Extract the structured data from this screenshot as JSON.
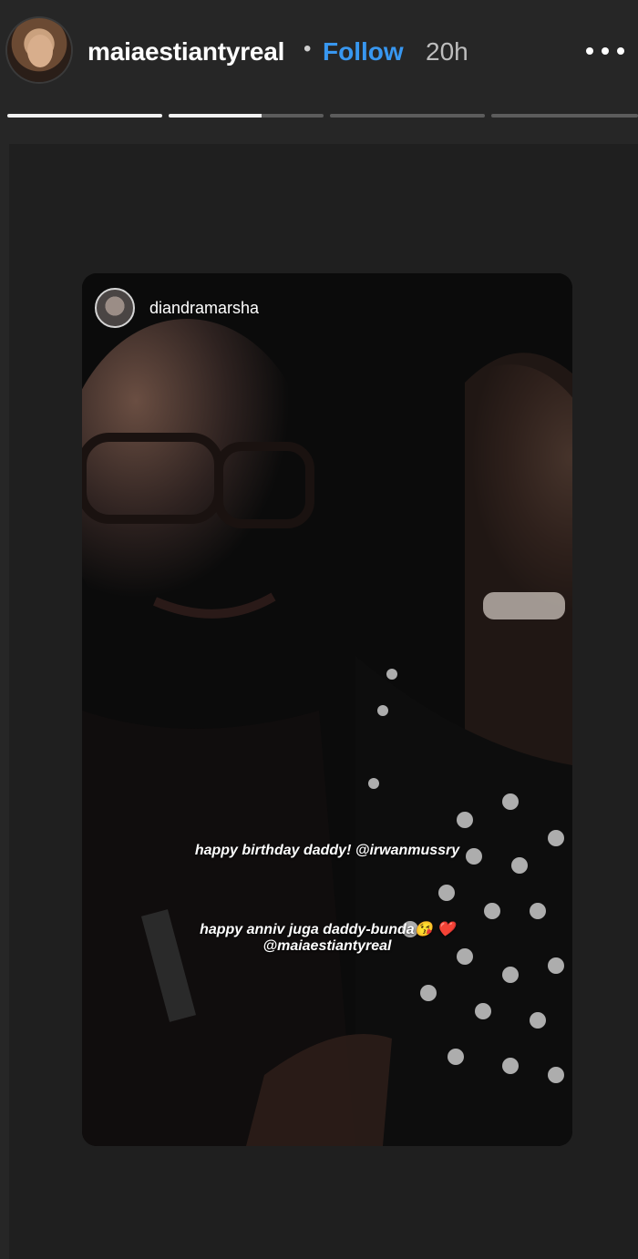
{
  "header": {
    "username": "maiaestiantyreal",
    "separator": "•",
    "follow_label": "Follow",
    "time": "20h",
    "more_icon": "more-dots-icon"
  },
  "progress_segments": [
    {
      "progress": 1.0
    },
    {
      "progress": 0.6
    },
    {
      "progress": 0.0
    },
    {
      "progress": 0.0
    }
  ],
  "shared_post": {
    "username": "diandramarsha",
    "caption_1": "happy birthday daddy! @irwanmussry",
    "caption_2_line1": "happy anniv juga daddy-bunda😘 ❤️",
    "caption_2_line2": "@maiaestiantyreal"
  }
}
